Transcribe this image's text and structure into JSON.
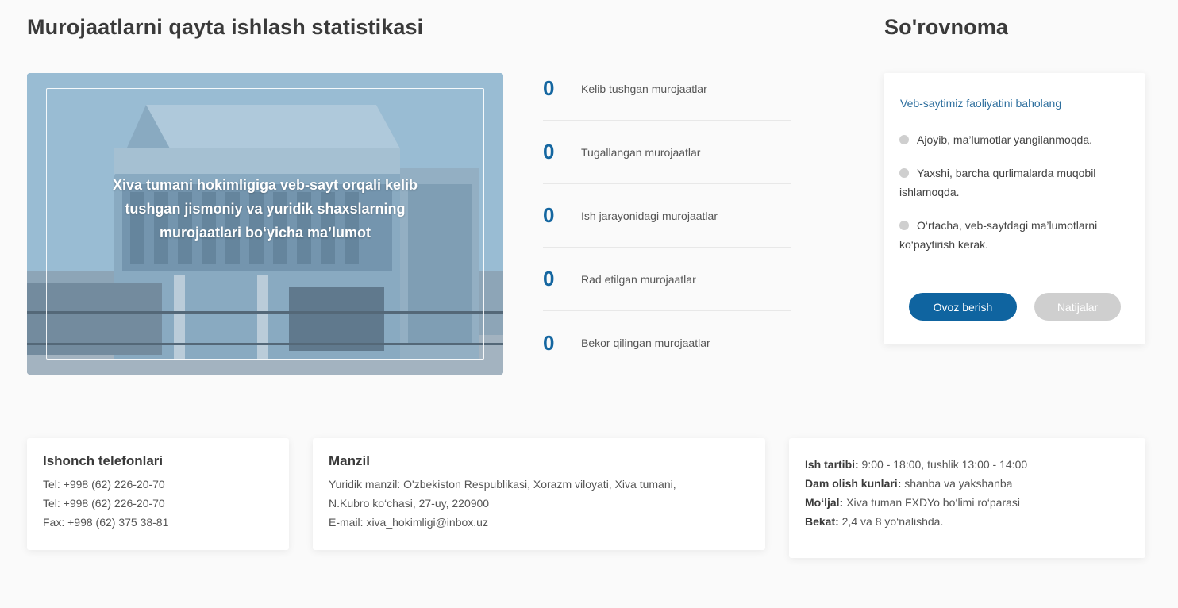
{
  "stats_section": {
    "title": "Murojaatlarni qayta ishlash statistikasi",
    "image_caption": "Xiva tumani hokimligiga veb-sayt orqali kelib tushgan jismoniy va yuridik shaxslarning murojaatlari bo‘yicha ma’lumot",
    "items": [
      {
        "count": "0",
        "label": "Kelib tushgan murojaatlar"
      },
      {
        "count": "0",
        "label": "Tugallangan murojaatlar"
      },
      {
        "count": "0",
        "label": "Ish jarayonidagi murojaatlar"
      },
      {
        "count": "0",
        "label": "Rad etilgan murojaatlar"
      },
      {
        "count": "0",
        "label": "Bekor qilingan murojaatlar"
      }
    ]
  },
  "survey": {
    "title": "So'rovnoma",
    "question": "Veb-saytimiz faoliyatini baholang",
    "options": [
      "Ajoyib, ma’lumotlar yangilanmoqda.",
      "Yaxshi, barcha qurlimalarda muqobil ishlamoqda.",
      "O‘rtacha, veb-saytdagi ma’lumotlarni ko‘paytirish kerak."
    ],
    "vote_label": "Ovoz berish",
    "results_label": "Natijalar"
  },
  "phones": {
    "title": "Ishonch telefonlari",
    "lines": [
      "Tel: +998 (62) 226-20-70",
      "Tel: +998 (62) 226-20-70",
      "Fax: +998 (62) 375 38-81"
    ]
  },
  "address": {
    "title": "Manzil",
    "lines": [
      "Yuridik manzil: O'zbekiston Respublikasi, Xorazm viloyati, Xiva tumani,",
      "N.Kubro ko‘chasi, 27-uy, 220900",
      "E-mail: xiva_hokimligi@inbox.uz"
    ]
  },
  "hours": {
    "rows": [
      {
        "label": "Ish tartibi:",
        "value": " 9:00 - 18:00, tushlik 13:00 - 14:00"
      },
      {
        "label": "Dam olish kunlari:",
        "value": " shanba va yakshanba"
      },
      {
        "label": "Mo‘ljal:",
        "value": " Xiva tuman FXDYo bo‘limi ro‘parasi"
      },
      {
        "label": "Bekat:",
        "value": " 2,4 va 8 yo‘nalishda."
      }
    ]
  },
  "colors": {
    "accent": "#0f64a0",
    "count": "#1466a0",
    "link": "#2e6f9e",
    "muted_button": "#cfcfcf"
  }
}
